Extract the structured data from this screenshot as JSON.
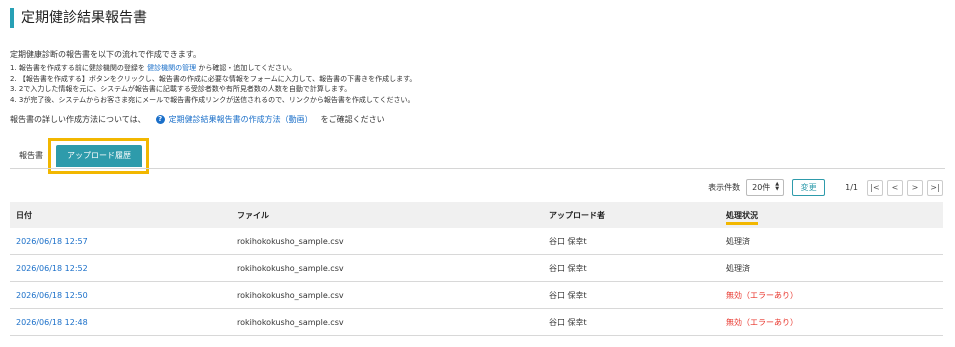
{
  "page": {
    "title": "定期健診結果報告書",
    "intro": "定期健康診断の報告書を以下の流れで作成できます。",
    "steps": [
      {
        "prefix": "1. 報告書を作成する前に健診機関の登録を ",
        "link": "健診機関の管理",
        "suffix": " から確認・追加してください。"
      },
      {
        "prefix": "2. 【報告書を作成する】ボタンをクリックし、報告書の作成に必要な情報をフォームに入力して、報告書の下書きを作成します。",
        "link": "",
        "suffix": ""
      },
      {
        "prefix": "3. 2で入力した情報を元に、システムが報告書に記載する受診者数や有所見者数の人数を自動で計算します。",
        "link": "",
        "suffix": ""
      },
      {
        "prefix": "4. 3が完了後、システムからお客さま宛にメールで報告書作成リンクが送信されるので、リンクから報告書を作成してください。",
        "link": "",
        "suffix": ""
      }
    ],
    "howto_prefix": "報告書の詳しい作成方法については、",
    "howto_link": "定期健診結果報告書の作成方法（動画）",
    "howto_suffix": "をご確認ください"
  },
  "tabs": [
    {
      "label": "報告書",
      "active": false
    },
    {
      "label": "アップロード履歴",
      "active": true
    }
  ],
  "pager": {
    "per_page_label": "表示件数",
    "per_page_value": "20件",
    "change_label": "変更",
    "page_indicator": "1/1",
    "first": "|<",
    "prev": "<",
    "next": ">",
    "last": ">|"
  },
  "table": {
    "headers": [
      "日付",
      "ファイル",
      "アップロード者",
      "処理状況"
    ],
    "rows": [
      {
        "date": "2026/06/18 12:57",
        "file": "rokihokokusho_sample.csv",
        "uploader": "谷口 保幸t",
        "status": "処理済"
      },
      {
        "date": "2026/06/18 12:52",
        "file": "rokihokokusho_sample.csv",
        "uploader": "谷口 保幸t",
        "status": "処理済"
      },
      {
        "date": "2026/06/18 12:50",
        "file": "rokihokokusho_sample.csv",
        "uploader": "谷口 保幸t",
        "status": "無効（エラーあり）"
      },
      {
        "date": "2026/06/18 12:48",
        "file": "rokihokokusho_sample.csv",
        "uploader": "谷口 保幸t",
        "status": "無効（エラーあり）"
      }
    ]
  },
  "colors": {
    "accent": "#2e9bab",
    "highlight": "#f2b700",
    "link": "#1a6fc9",
    "error": "#e8352c"
  }
}
